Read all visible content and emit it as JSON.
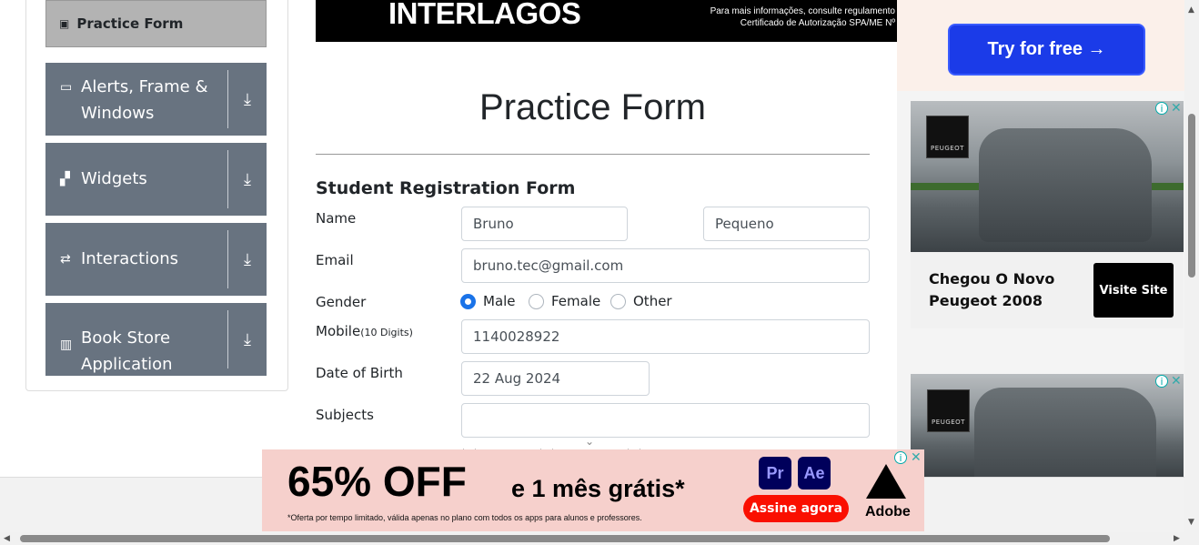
{
  "sidebar": {
    "active_item": "Practice Form",
    "groups": [
      {
        "label_line1": "Alerts, Frame &",
        "label_line2": "Windows"
      },
      {
        "label_line1": "Widgets",
        "label_line2": ""
      },
      {
        "label_line1": "Interactions",
        "label_line2": ""
      },
      {
        "label_line1": "Book Store",
        "label_line2": "Application"
      }
    ]
  },
  "top_banner": {
    "brand": "INTERLAGOS",
    "fine_line1": "Para mais informações, consulte regulamento",
    "fine_line2": "Certificado de Autorização SPA/ME Nº"
  },
  "page": {
    "title": "Practice Form",
    "subtitle": "Student Registration Form"
  },
  "form": {
    "name_label": "Name",
    "first_name": "Bruno",
    "last_name": "Pequeno",
    "email_label": "Email",
    "email": "bruno.tec@gmail.com",
    "gender_label": "Gender",
    "gender_options": [
      "Male",
      "Female",
      "Other"
    ],
    "gender_selected": "Male",
    "mobile_label": "Mobile",
    "mobile_hint": "(10 Digits)",
    "mobile": "1140028922",
    "dob_label": "Date of Birth",
    "dob": "22 Aug 2024",
    "subjects_label": "Subjects",
    "subjects_value": ""
  },
  "ads": {
    "try_button": "Try for free →",
    "peugeot_headline_line1": "Chegou O Novo",
    "peugeot_headline_line2": "Peugeot 2008",
    "peugeot_cta": "Visite Site",
    "peugeot_brand": "PEUGEOT",
    "bottom_big": "65% OFF",
    "bottom_mid": "e 1 mês grátis*",
    "bottom_fine": "*Oferta por tempo limitado, válida apenas no plano com todos os apps para alunos e professores.",
    "bottom_cta": "Assine agora",
    "app1": "Pr",
    "app2": "Ae",
    "bottom_brand": "Adobe"
  },
  "colors": {
    "sidebar_group": "#687380",
    "radio_selected": "#1a73e8",
    "try_button": "#1b3be8",
    "cta_red": "#fa0f00"
  }
}
